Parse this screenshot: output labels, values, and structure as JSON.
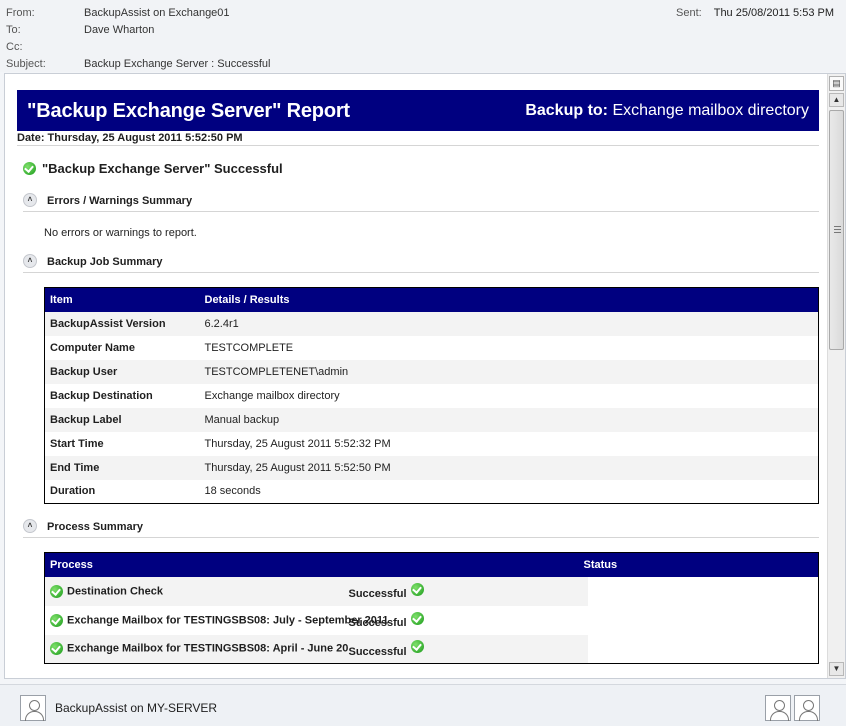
{
  "header": {
    "from_label": "From:",
    "from_value": "BackupAssist on Exchange01",
    "to_label": "To:",
    "to_value": "Dave Wharton",
    "cc_label": "Cc:",
    "subject_label": "Subject:",
    "subject_value": "Backup Exchange Server : Successful",
    "sent_label": "Sent:",
    "sent_value": "Thu 25/08/2011 5:53 PM"
  },
  "report": {
    "title": "\"Backup Exchange Server\" Report",
    "backup_to_label": "Backup to:",
    "backup_to_value": "Exchange mailbox directory",
    "date": "Date: Thursday, 25 August 2011 5:52:50 PM",
    "status_line": "\"Backup Exchange Server\" Successful"
  },
  "errors_section": {
    "heading": "Errors / Warnings Summary",
    "text": "No errors or warnings to report."
  },
  "job_section": {
    "heading": "Backup Job Summary",
    "col_item": "Item",
    "col_details": "Details  /  Results",
    "rows": [
      {
        "item": "BackupAssist Version",
        "value": "6.2.4r1"
      },
      {
        "item": "Computer Name",
        "value": "TESTCOMPLETE"
      },
      {
        "item": "Backup User",
        "value": "TESTCOMPLETENET\\admin"
      },
      {
        "item": "Backup Destination",
        "value": "Exchange mailbox directory"
      },
      {
        "item": "Backup Label",
        "value": "Manual backup"
      },
      {
        "item": "Start Time",
        "value": "Thursday, 25 August 2011 5:52:32 PM"
      },
      {
        "item": "End Time",
        "value": "Thursday, 25 August 2011 5:52:50 PM"
      },
      {
        "item": "Duration",
        "value": "18 seconds"
      }
    ]
  },
  "process_section": {
    "heading": "Process Summary",
    "col_process": "Process",
    "col_status": "Status",
    "rows": [
      {
        "process": "Destination Check",
        "status": "Successful"
      },
      {
        "process": "Exchange Mailbox for TESTINGSBS08: July - September 2011",
        "status": "Successful"
      },
      {
        "process": "Exchange Mailbox for TESTINGSBS08: April - June 2011",
        "status": "Successful"
      }
    ]
  },
  "footer": {
    "sender_name": "BackupAssist on MY-SERVER"
  },
  "colors": {
    "banner": "#000080",
    "success": "#1a9a1a"
  }
}
